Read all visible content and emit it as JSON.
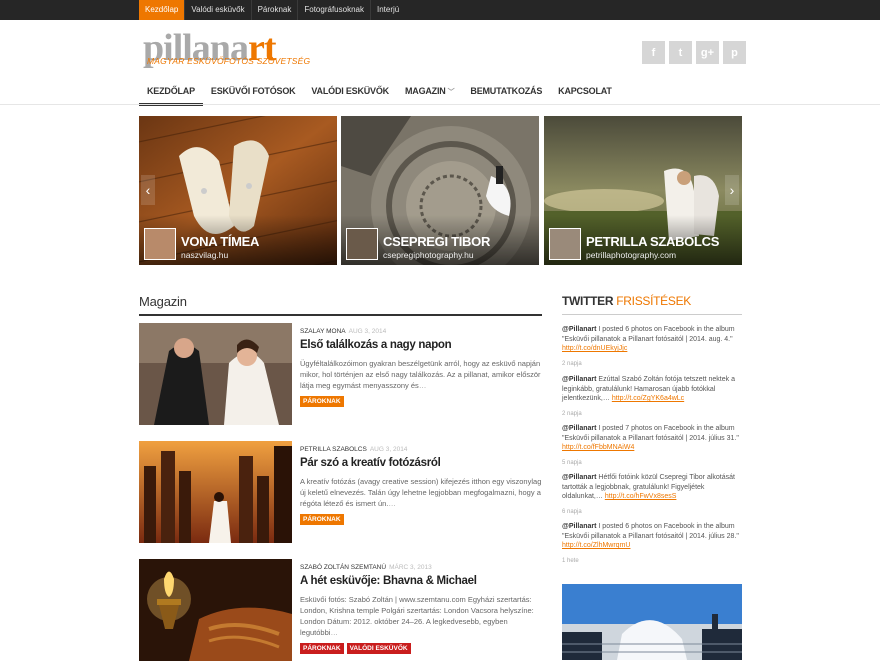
{
  "topnav": [
    "Kezdőlap",
    "Valódi esküvők",
    "Pároknak",
    "Fotográfusoknak",
    "Interjú"
  ],
  "logo": {
    "main_a": "pillana",
    "main_b": "rt",
    "sub": "MAGYAR ESKÜVŐFOTÓS SZÖVETSÉG"
  },
  "social": [
    {
      "icon": "facebook-icon",
      "glyph": "f"
    },
    {
      "icon": "twitter-icon",
      "glyph": "t"
    },
    {
      "icon": "google-plus-icon",
      "glyph": "g+"
    },
    {
      "icon": "pinterest-icon",
      "glyph": "p"
    }
  ],
  "mainnav": [
    "KEZDŐLAP",
    "ESKÜVŐI FOTÓSOK",
    "VALÓDI ESKÜVŐK",
    "MAGAZIN",
    "BEMUTATKOZÁS",
    "KAPCSOLAT"
  ],
  "slides": [
    {
      "name": "VONA TÍMEA",
      "site": "naszvilag.hu"
    },
    {
      "name": "CSEPREGI TIBOR",
      "site": "csepregiphotography.hu"
    },
    {
      "name": "PETRILLA SZABOLCS",
      "site": "petrillaphotography.com"
    }
  ],
  "magazin": {
    "title": "Magazin",
    "posts": [
      {
        "author": "SZALAY MONA",
        "date": "AUG 3, 2014",
        "title": "Első találkozás a nagy napon",
        "excerpt": "Ügyféltalálkozóimon gyakran beszélgetünk arról, hogy az esküvő napján mikor, hol történjen az első nagy találkozás. Az a pillanat, amikor először látja meg egymást menyasszony és",
        "more": "…",
        "tags": [
          "PÁROKNAK"
        ]
      },
      {
        "author": "PETRILLA SZABOLCS",
        "date": "AUG 3, 2014",
        "title": "Pár szó a kreatív fotózásról",
        "excerpt": "A kreatív fotózás (avagy creative session) kifejezés itthon egy viszonylag új keletű elnevezés. Talán úgy lehetne legjobban megfogalmazni, hogy a régóta létező és ismert ún.",
        "more": "…",
        "tags": [
          "PÁROKNAK"
        ]
      },
      {
        "author": "SZABÓ ZOLTÁN SZEMTANÚ",
        "date": "MÁRC 3, 2013",
        "title": "A hét esküvője: Bhavna & Michael",
        "excerpt": "Esküvői fotós: Szabó Zoltán | www.szemtanu.com Egyházi szertartás: London, Krishna temple Polgári szertartás: London Vacsora helyszíne: London Dátum: 2012. október 24–26. A legkedvesebb, egyben legutóbbi",
        "more": "…",
        "tags": [
          "PÁROKNAK",
          "VALÓDI ESKÜVŐK"
        ]
      }
    ]
  },
  "twitter": {
    "title_a": "TWITTER",
    "title_b": "FRISSÍTÉSEK",
    "tweets": [
      {
        "handle": "@Pillanart",
        "text": "I posted 6 photos on Facebook in the album \"Esküvői pillanatok a Pillanart fotósaitól | 2014. aug. 4.\"",
        "link": "http://t.co/dnUEkyjJjc",
        "ago": "2 napja"
      },
      {
        "handle": "@Pillanart",
        "text": "Ezúttal Szabó Zoltán fotója tetszett nektek a leginkább, gratulálunk! Hamarosan újabb fotókkal jelentkezünk,…",
        "link": "http://t.co/ZgYK6a4wLc",
        "ago": "2 napja"
      },
      {
        "handle": "@Pillanart",
        "text": "I posted 7 photos on Facebook in the album \"Esküvői pillanatok a Pillanart fotósaitól | 2014. július 31.\"",
        "link": "http://t.co/fFbbMNAiW4",
        "ago": "5 napja"
      },
      {
        "handle": "@Pillanart",
        "text": "Hétfői fotóink közül Csepregi Tibor alkotását tartották a legjobbnak, gratulálunk! Figyeljétek oldalunkat,…",
        "link": "http://t.co/hFwVx8sesS",
        "ago": "6 napja"
      },
      {
        "handle": "@Pillanart",
        "text": "I posted 6 photos on Facebook in the album \"Esküvői pillanatok a Pillanart fotósaitól | 2014. július 28.\"",
        "link": "http://t.co/ZlhMwrqmU",
        "ago": "1 hete"
      }
    ]
  }
}
